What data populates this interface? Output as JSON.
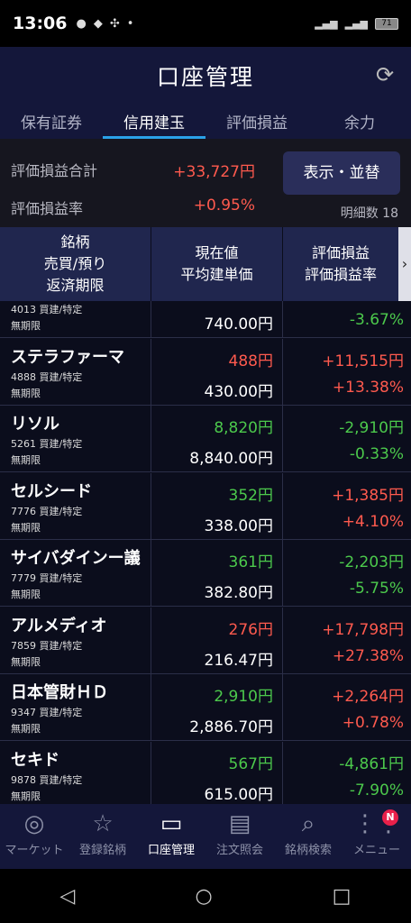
{
  "status": {
    "time": "13:06",
    "battery": "71"
  },
  "header": {
    "title": "口座管理"
  },
  "tabs": [
    "保有証券",
    "信用建玉",
    "評価損益",
    "余力"
  ],
  "summary": {
    "pl_total_label": "評価損益合計",
    "pl_total_value": "+33,727円",
    "pl_rate_label": "評価損益率",
    "pl_rate_value": "+0.95%",
    "display_button": "表示・並替",
    "count_label": "明細数 18"
  },
  "table_header": {
    "col1": [
      "銘柄",
      "売買/預り",
      "返済期限"
    ],
    "col2": [
      "現在値",
      "平均建単価"
    ],
    "col3": [
      "評価損益",
      "評価損益率"
    ]
  },
  "rows": [
    {
      "name": "",
      "code_type": "4013 買建/特定",
      "term": "無期限",
      "price": "",
      "avg": "740.00円",
      "pl": "",
      "rate": "-3.67%",
      "price_dir": "up",
      "pl_dir": "dn",
      "rate_dir": "dn"
    },
    {
      "name": "ステラファーマ",
      "code_type": "4888 買建/特定",
      "term": "無期限",
      "price": "488円",
      "avg": "430.00円",
      "pl": "+11,515円",
      "rate": "+13.38%",
      "price_dir": "up",
      "pl_dir": "up",
      "rate_dir": "up"
    },
    {
      "name": "リソル",
      "code_type": "5261 買建/特定",
      "term": "無期限",
      "price": "8,820円",
      "avg": "8,840.00円",
      "pl": "-2,910円",
      "rate": "-0.33%",
      "price_dir": "dn",
      "pl_dir": "dn",
      "rate_dir": "dn"
    },
    {
      "name": "セルシード",
      "code_type": "7776 買建/特定",
      "term": "無期限",
      "price": "352円",
      "avg": "338.00円",
      "pl": "+1,385円",
      "rate": "+4.10%",
      "price_dir": "dn",
      "pl_dir": "up",
      "rate_dir": "up"
    },
    {
      "name": "サイバダインー議",
      "code_type": "7779 買建/特定",
      "term": "無期限",
      "price": "361円",
      "avg": "382.80円",
      "pl": "-2,203円",
      "rate": "-5.75%",
      "price_dir": "dn",
      "pl_dir": "dn",
      "rate_dir": "dn"
    },
    {
      "name": "アルメディオ",
      "code_type": "7859 買建/特定",
      "term": "無期限",
      "price": "276円",
      "avg": "216.47円",
      "pl": "+17,798円",
      "rate": "+27.38%",
      "price_dir": "up",
      "pl_dir": "up",
      "rate_dir": "up"
    },
    {
      "name": "日本管財ＨＤ",
      "code_type": "9347 買建/特定",
      "term": "無期限",
      "price": "2,910円",
      "avg": "2,886.70円",
      "pl": "+2,264円",
      "rate": "+0.78%",
      "price_dir": "dn",
      "pl_dir": "up",
      "rate_dir": "up"
    },
    {
      "name": "セキド",
      "code_type": "9878 買建/特定",
      "term": "無期限",
      "price": "567円",
      "avg": "615.00円",
      "pl": "-4,861円",
      "rate": "-7.90%",
      "price_dir": "dn",
      "pl_dir": "dn",
      "rate_dir": "dn"
    }
  ],
  "bottom_nav": [
    {
      "label": "マーケット",
      "icon": "globe-icon"
    },
    {
      "label": "登録銘柄",
      "icon": "star-icon"
    },
    {
      "label": "口座管理",
      "icon": "card-icon"
    },
    {
      "label": "注文照会",
      "icon": "document-icon"
    },
    {
      "label": "銘柄検索",
      "icon": "search-icon"
    },
    {
      "label": "メニュー",
      "icon": "grid-icon",
      "badge": "N"
    }
  ]
}
